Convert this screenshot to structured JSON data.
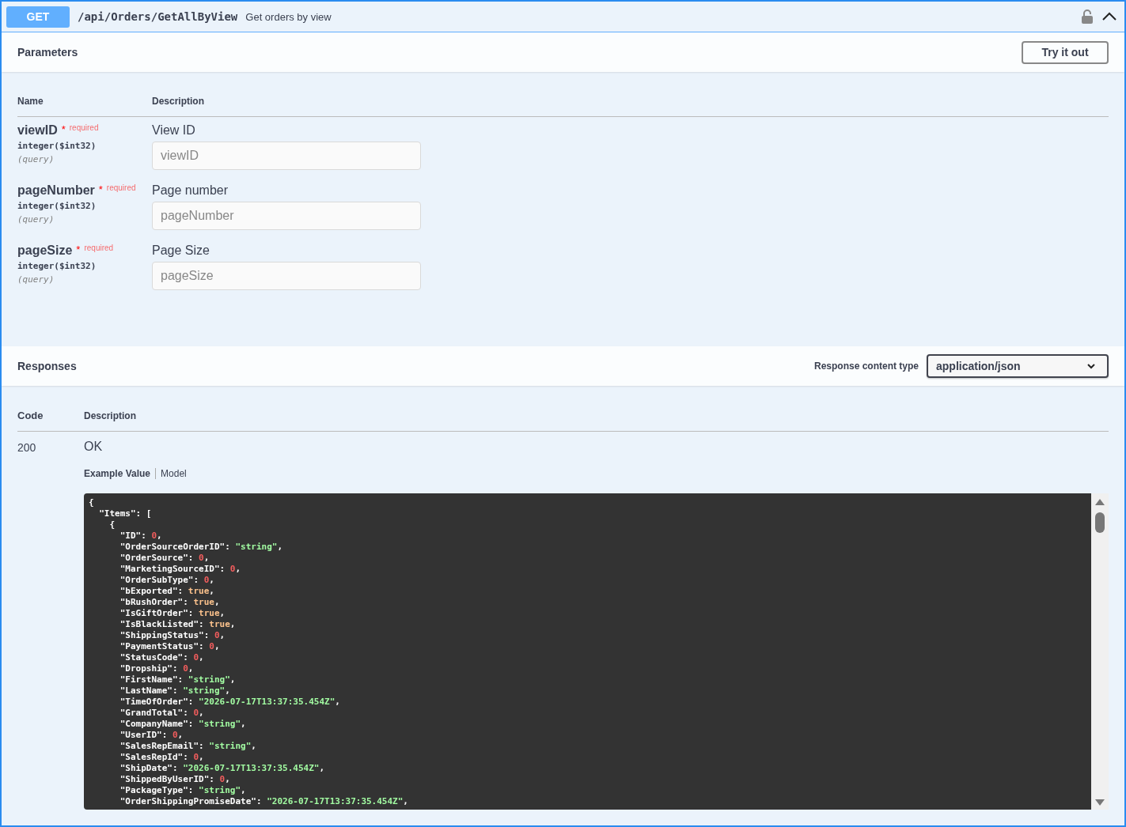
{
  "operation": {
    "method": "GET",
    "path": "/api/Orders/GetAllByView",
    "summary": "Get orders by view"
  },
  "parameters": {
    "title": "Parameters",
    "try_button": "Try it out",
    "columns": [
      "Name",
      "Description"
    ],
    "items": [
      {
        "name": "viewID",
        "required_mark": "*",
        "required": "required",
        "type": "integer",
        "format": "($int32)",
        "location": "(query)",
        "description": "View ID",
        "placeholder": "viewID"
      },
      {
        "name": "pageNumber",
        "required_mark": "*",
        "required": "required",
        "type": "integer",
        "format": "($int32)",
        "location": "(query)",
        "description": "Page number",
        "placeholder": "pageNumber"
      },
      {
        "name": "pageSize",
        "required_mark": "*",
        "required": "required",
        "type": "integer",
        "format": "($int32)",
        "location": "(query)",
        "description": "Page Size",
        "placeholder": "pageSize"
      }
    ]
  },
  "responses": {
    "title": "Responses",
    "content_type_label": "Response content type",
    "content_type": "application/json",
    "columns": [
      "Code",
      "Description"
    ],
    "items": [
      {
        "code": "200",
        "description": "OK",
        "tabs": [
          {
            "label": "Example Value",
            "selected": true
          },
          {
            "label": "Model",
            "selected": false
          }
        ],
        "example_lines": [
          {
            "k": "{"
          },
          {
            "k": "  \"Items\": ["
          },
          {
            "k": "    {"
          },
          {
            "k": "      \"ID\": ",
            "v": "0",
            "kind": "number",
            "end": ","
          },
          {
            "k": "      \"OrderSourceOrderID\": ",
            "v": "\"string\"",
            "kind": "string",
            "end": ","
          },
          {
            "k": "      \"OrderSource\": ",
            "v": "0",
            "kind": "number",
            "end": ","
          },
          {
            "k": "      \"MarketingSourceID\": ",
            "v": "0",
            "kind": "number",
            "end": ","
          },
          {
            "k": "      \"OrderSubType\": ",
            "v": "0",
            "kind": "number",
            "end": ","
          },
          {
            "k": "      \"bExported\": ",
            "v": "true",
            "kind": "boolean",
            "end": ","
          },
          {
            "k": "      \"bRushOrder\": ",
            "v": "true",
            "kind": "boolean",
            "end": ","
          },
          {
            "k": "      \"IsGiftOrder\": ",
            "v": "true",
            "kind": "boolean",
            "end": ","
          },
          {
            "k": "      \"IsBlackListed\": ",
            "v": "true",
            "kind": "boolean",
            "end": ","
          },
          {
            "k": "      \"ShippingStatus\": ",
            "v": "0",
            "kind": "number",
            "end": ","
          },
          {
            "k": "      \"PaymentStatus\": ",
            "v": "0",
            "kind": "number",
            "end": ","
          },
          {
            "k": "      \"StatusCode\": ",
            "v": "0",
            "kind": "number",
            "end": ","
          },
          {
            "k": "      \"Dropship\": ",
            "v": "0",
            "kind": "number",
            "end": ","
          },
          {
            "k": "      \"FirstName\": ",
            "v": "\"string\"",
            "kind": "string",
            "end": ","
          },
          {
            "k": "      \"LastName\": ",
            "v": "\"string\"",
            "kind": "string",
            "end": ","
          },
          {
            "k": "      \"TimeOfOrder\": ",
            "v": "\"2026-07-17T13:37:35.454Z\"",
            "kind": "string",
            "end": ","
          },
          {
            "k": "      \"GrandTotal\": ",
            "v": "0",
            "kind": "number",
            "end": ","
          },
          {
            "k": "      \"CompanyName\": ",
            "v": "\"string\"",
            "kind": "string",
            "end": ","
          },
          {
            "k": "      \"UserID\": ",
            "v": "0",
            "kind": "number",
            "end": ","
          },
          {
            "k": "      \"SalesRepEmail\": ",
            "v": "\"string\"",
            "kind": "string",
            "end": ","
          },
          {
            "k": "      \"SalesRepId\": ",
            "v": "0",
            "kind": "number",
            "end": ","
          },
          {
            "k": "      \"ShipDate\": ",
            "v": "\"2026-07-17T13:37:35.454Z\"",
            "kind": "string",
            "end": ","
          },
          {
            "k": "      \"ShippedByUserID\": ",
            "v": "0",
            "kind": "number",
            "end": ","
          },
          {
            "k": "      \"PackageType\": ",
            "v": "\"string\"",
            "kind": "string",
            "end": ","
          },
          {
            "k": "      \"OrderShippingPromiseDate\": ",
            "v": "\"2026-07-17T13:37:35.454Z\"",
            "kind": "string",
            "end": ","
          }
        ]
      }
    ]
  }
}
